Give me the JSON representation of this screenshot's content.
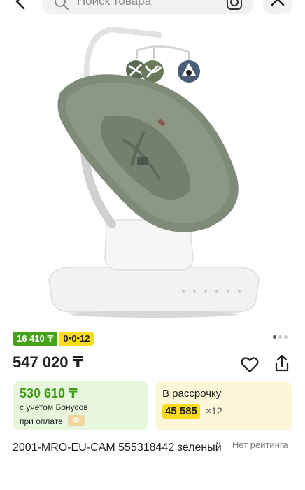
{
  "search": {
    "placeholder": "Поиск товара"
  },
  "badges": {
    "bonus": "16 410 ₸",
    "installment": "0•0•12"
  },
  "pager": {
    "count": 3,
    "active": 0
  },
  "price": "547 020 ₸",
  "bonus_card": {
    "price": "530 610 ₸",
    "line1": "с учетом Бонусов",
    "line2": "при оплате",
    "chip": "Ф"
  },
  "installment_card": {
    "title": "В рассрочку",
    "amount": "45 585",
    "times": "×12"
  },
  "product": {
    "name": "2001-MRO-EU-CAM 555318442 зеленый",
    "rating": "Нет рейтинга"
  },
  "colors": {
    "accent_green": "#44a317",
    "accent_yellow": "#fbdb1e",
    "bonus_bg": "#e7f6dd",
    "installment_bg": "#fcf7d8"
  },
  "icons": [
    "back-arrow-icon",
    "search-icon",
    "camera-icon",
    "close-icon",
    "heart-icon",
    "share-icon"
  ]
}
